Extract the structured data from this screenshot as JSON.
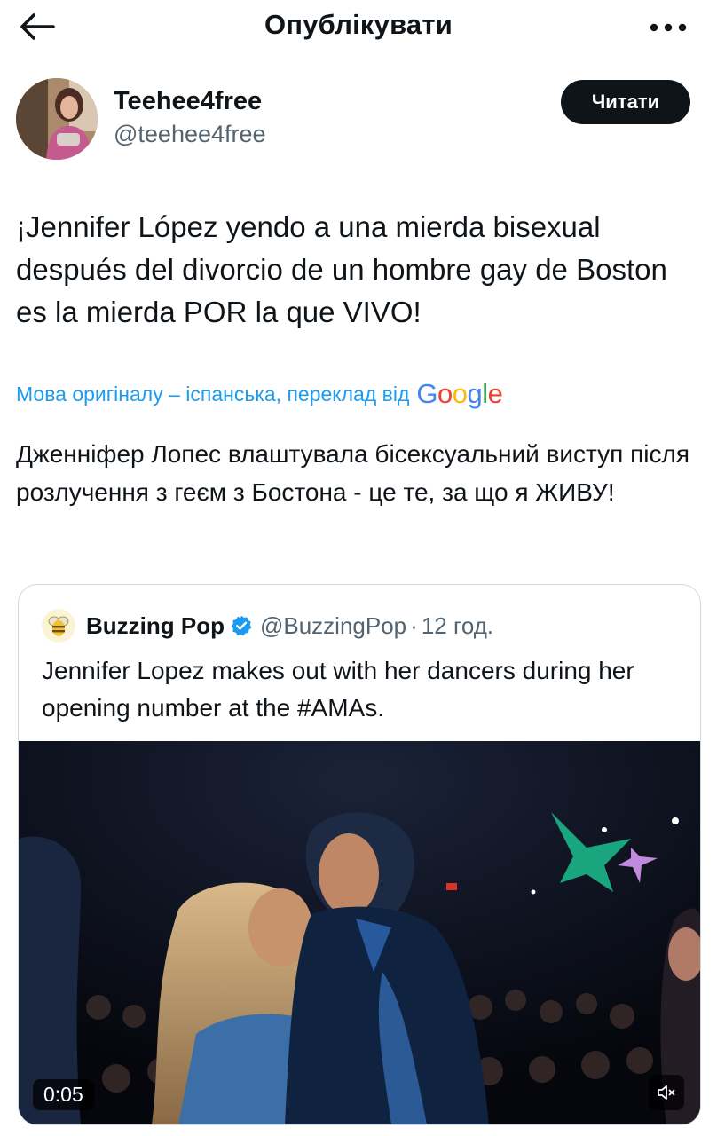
{
  "header": {
    "title": "Опублікувати",
    "back_icon": "arrow-left-icon",
    "more_icon": "more-horizontal-icon"
  },
  "author": {
    "name": "Teehee4free",
    "handle": "@teehee4free",
    "follow_label": "Читати"
  },
  "tweet": {
    "text": "¡Jennifer López yendo a una mierda bisexual después del divorcio de un hombre gay de Boston es la mierda POR la que VIVO!",
    "translation_note": "Мова оригіналу – іспанська, переклад від",
    "translation_provider": "Google",
    "translated_text": "Дженніфер Лопес влаштувала бісексуальний виступ після розлучення з геєм з Бостона - це те, за що я ЖИВУ!"
  },
  "quote": {
    "name": "Buzzing Pop",
    "handle": "@BuzzingPop",
    "separator": "·",
    "time": "12 год.",
    "text": "Jennifer Lopez makes out with her dancers during her opening number at the #AMAs.",
    "video": {
      "duration": "0:05",
      "mute_icon": "speaker-muted-icon"
    }
  },
  "colors": {
    "text_primary": "#0f1419",
    "text_secondary": "#536471",
    "link": "#1d9bf0",
    "button_bg": "#0f1419",
    "border": "#cfd9de",
    "verified": "#1d9bf0"
  }
}
